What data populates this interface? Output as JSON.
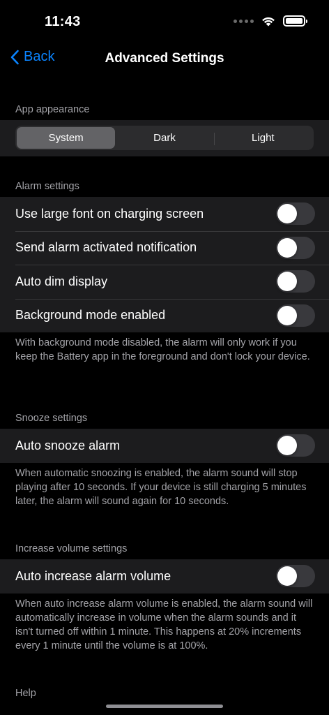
{
  "status_bar": {
    "time": "11:43"
  },
  "nav": {
    "back_label": "Back",
    "title": "Advanced Settings"
  },
  "appearance": {
    "header": "App appearance",
    "segments": [
      "System",
      "Dark",
      "Light"
    ],
    "selected": "System"
  },
  "alarm": {
    "header": "Alarm settings",
    "rows": [
      {
        "label": "Use large font on charging screen",
        "on": false
      },
      {
        "label": "Send alarm activated notification",
        "on": false
      },
      {
        "label": "Auto dim display",
        "on": false
      },
      {
        "label": "Background mode enabled",
        "on": false
      }
    ],
    "footer": "With background mode disabled, the alarm will only work if you keep the Battery app in the foreground and don't lock your device."
  },
  "snooze": {
    "header": "Snooze settings",
    "rows": [
      {
        "label": "Auto snooze alarm",
        "on": false
      }
    ],
    "footer": "When automatic snoozing is enabled, the alarm sound will stop playing after 10 seconds. If your device is still charging 5 minutes later, the alarm will sound again for 10 seconds."
  },
  "volume": {
    "header": "Increase volume settings",
    "rows": [
      {
        "label": "Auto increase alarm volume",
        "on": false
      }
    ],
    "footer": "When auto increase alarm volume is enabled, the alarm sound will automatically increase in volume when the alarm sounds and it isn't turned off within 1 minute. This happens at 20% increments every 1 minute until the volume is at 100%."
  },
  "help": {
    "header": "Help"
  },
  "colors": {
    "accent": "#0a84ff",
    "background": "#000000",
    "group": "#1c1c1e",
    "secondary_text": "#a3a3a8"
  }
}
